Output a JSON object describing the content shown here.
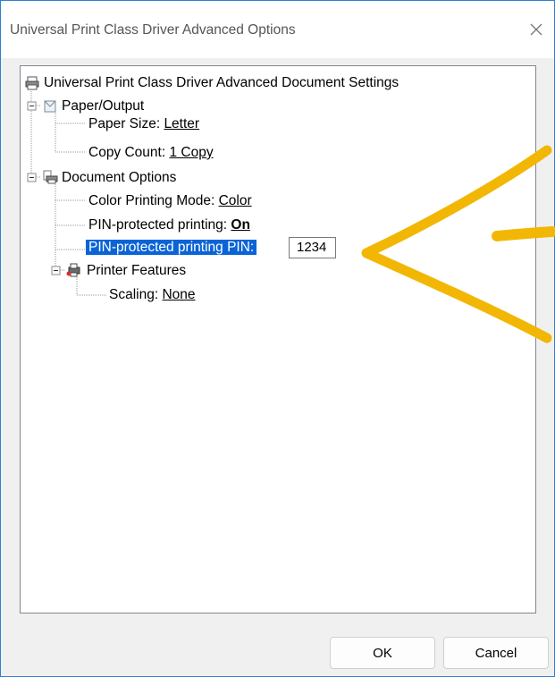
{
  "window": {
    "title": "Universal Print Class Driver Advanced Options"
  },
  "tree": {
    "root": "Universal Print Class Driver Advanced Document Settings",
    "paper_output": {
      "label": "Paper/Output",
      "paper_size_label": "Paper Size: ",
      "paper_size_value": "Letter",
      "copy_count_label": "Copy Count: ",
      "copy_count_value": "1 Copy"
    },
    "document_options": {
      "label": "Document Options",
      "color_mode_label": "Color Printing Mode: ",
      "color_mode_value": "Color",
      "pin_printing_label": "PIN-protected printing: ",
      "pin_printing_value": "On",
      "pin_label": "PIN-protected printing PIN:",
      "pin_value": "1234"
    },
    "printer_features": {
      "label": "Printer Features",
      "scaling_label": "Scaling: ",
      "scaling_value": "None"
    }
  },
  "buttons": {
    "ok": "OK",
    "cancel": "Cancel"
  },
  "colors": {
    "selection": "#0a64d6",
    "annotation_arrow": "#f2b705",
    "window_border": "#2f7fcf"
  }
}
